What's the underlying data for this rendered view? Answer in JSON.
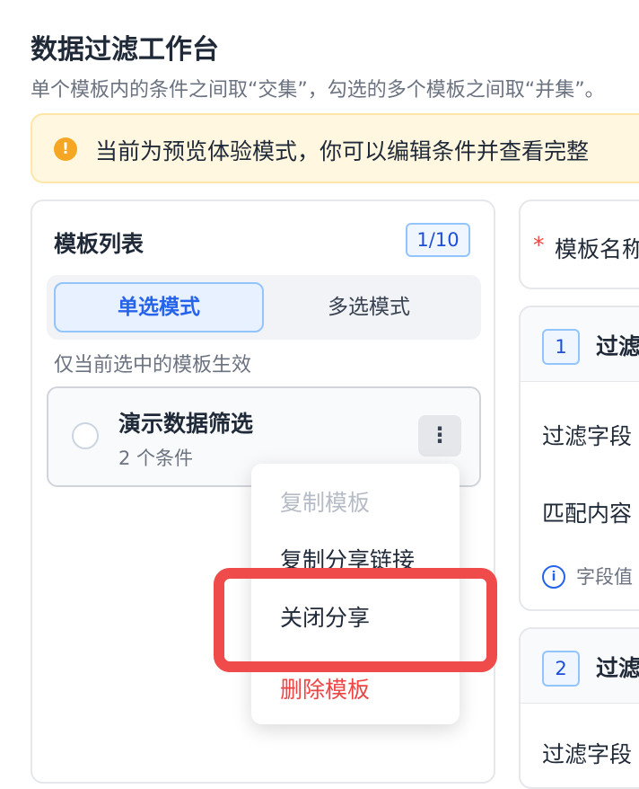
{
  "page": {
    "title": "数据过滤工作台",
    "subtitle": "单个模板内的条件之间取“交集”，勾选的多个模板之间取“并集”。"
  },
  "alert": {
    "icon": "warning-icon",
    "icon_glyph": "!",
    "text": "当前为预览体验模式，你可以编辑条件并查看完整"
  },
  "template_list": {
    "title": "模板列表",
    "count": "1/10",
    "modes": {
      "single": "单选模式",
      "multi": "多选模式",
      "selected": "single"
    },
    "hint": "仅当前选中的模板生效",
    "items": [
      {
        "name": "演示数据筛选",
        "sub": "2 个条件",
        "more_glyph": "⋮"
      }
    ]
  },
  "context_menu": {
    "items": [
      {
        "label": "复制模板",
        "state": "disabled"
      },
      {
        "label": "复制分享链接",
        "state": "normal"
      },
      {
        "label": "关闭分享",
        "state": "highlighted"
      },
      {
        "label": "删除模板",
        "state": "danger"
      }
    ],
    "highlight_color": "#f04b4b"
  },
  "editor": {
    "name_required": "*",
    "name_label": "模板名称",
    "filters": [
      {
        "index": "1",
        "title": "过滤",
        "field_label": "过滤字段",
        "match_label": "匹配内容",
        "info_icon": "i",
        "info_text": "字段值"
      },
      {
        "index": "2",
        "title": "过滤",
        "field_label": "过滤字段"
      }
    ]
  },
  "colors": {
    "accent": "#2563eb",
    "danger": "#ef4444",
    "warning": "#f5a623"
  }
}
